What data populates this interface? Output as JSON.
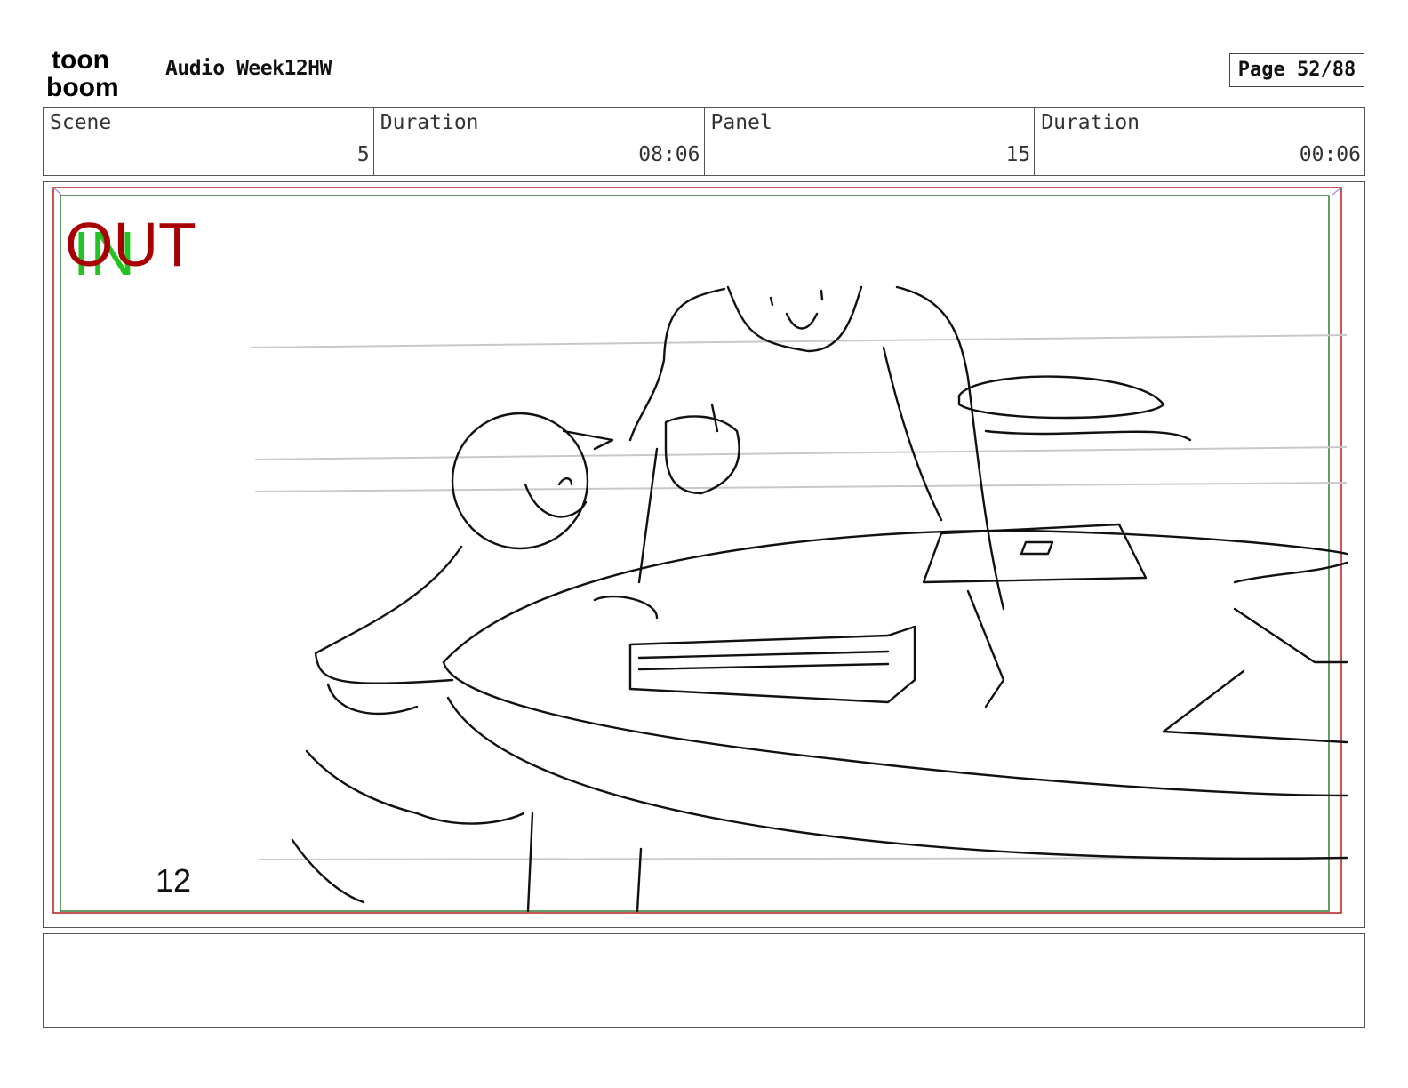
{
  "header": {
    "logo": {
      "text_line1": "toon",
      "text_line2": "boom"
    },
    "title": "Audio Week12HW",
    "page": "Page 52/88"
  },
  "info": {
    "scene_label": "Scene",
    "scene_value": "5",
    "scene_duration_label": "Duration",
    "scene_duration_value": "08:06",
    "panel_label": "Panel",
    "panel_value": "15",
    "panel_duration_label": "Duration",
    "panel_duration_value": "00:06"
  },
  "panel": {
    "out_marker": "OUT",
    "in_marker": "IN",
    "sketch_number": "12",
    "colors": {
      "out": "#a80000",
      "in": "#22c322",
      "safe_green": "#2e7d32",
      "safe_red": "#b71c1c"
    }
  },
  "notes": {
    "text": ""
  }
}
